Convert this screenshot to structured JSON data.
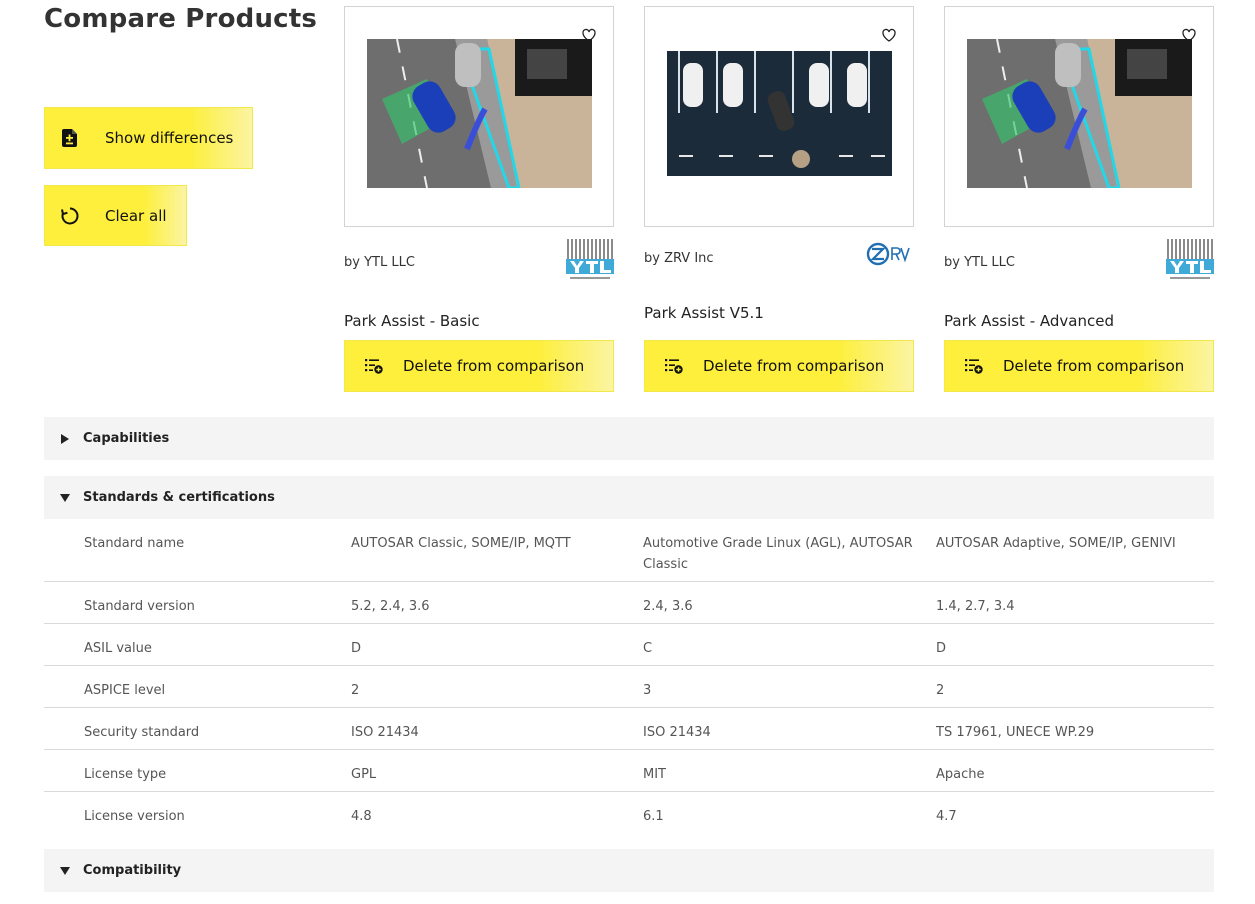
{
  "page": {
    "title": "Compare Products"
  },
  "actions": {
    "show_differences": "Show differences",
    "clear_all": "Clear all"
  },
  "products": [
    {
      "vendor": "by YTL LLC",
      "name": "Park Assist - Basic",
      "delete_label": "Delete from comparison",
      "logo": "YTL"
    },
    {
      "vendor": "by ZRV Inc",
      "name": "Park Assist V5.1",
      "delete_label": "Delete from comparison",
      "logo": "ZRV"
    },
    {
      "vendor": "by YTL LLC",
      "name": "Park Assist - Advanced",
      "delete_label": "Delete from comparison",
      "logo": "YTL"
    }
  ],
  "sections": [
    {
      "title": "Capabilities",
      "expanded": false
    },
    {
      "title": "Standards & certifications",
      "expanded": true
    },
    {
      "title": "Compatibility",
      "expanded": true
    }
  ],
  "spec_rows": [
    {
      "label": "Standard name",
      "values": [
        "AUTOSAR Classic, SOME/IP, MQTT",
        "Automotive Grade Linux (AGL), AUTOSAR Classic",
        "AUTOSAR Adaptive, SOME/IP, GENIVI"
      ]
    },
    {
      "label": "Standard version",
      "values": [
        "5.2, 2.4, 3.6",
        "2.4, 3.6",
        "1.4, 2.7, 3.4"
      ]
    },
    {
      "label": "ASIL value",
      "values": [
        "D",
        "C",
        "D"
      ]
    },
    {
      "label": "ASPICE level",
      "values": [
        "2",
        "3",
        "2"
      ]
    },
    {
      "label": "Security standard",
      "values": [
        "ISO 21434",
        "ISO 21434",
        "TS 17961, UNECE WP.29"
      ]
    },
    {
      "label": "License type",
      "values": [
        "GPL",
        "MIT",
        "Apache"
      ]
    },
    {
      "label": "License version",
      "values": [
        "4.8",
        "6.1",
        "4.7"
      ]
    }
  ],
  "colors": {
    "accent_yellow": "#fdef3c",
    "section_bg": "#f4f4f4",
    "ytl_blue": "#3fa9d8",
    "zrv_blue": "#1f6fb2"
  }
}
